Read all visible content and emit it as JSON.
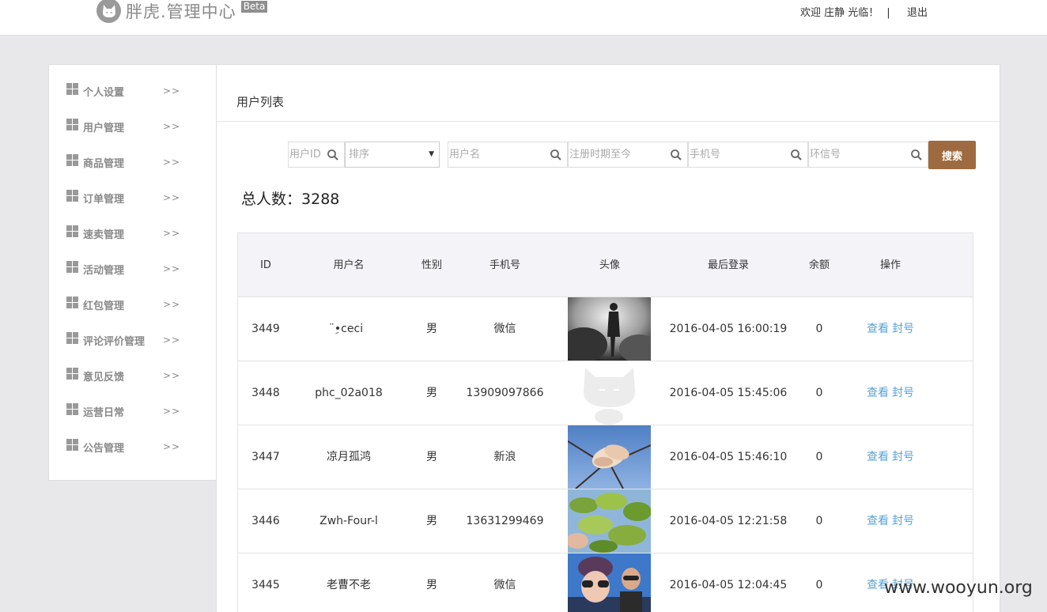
{
  "header": {
    "logo_text": "胖虎.管理中心",
    "beta": "Beta",
    "welcome": "欢迎 庄静 光临！",
    "separator": "|",
    "logout": "退出"
  },
  "sidebar": {
    "items": [
      {
        "label": "个人设置",
        "arrow": ">>"
      },
      {
        "label": "用户管理",
        "arrow": ">>"
      },
      {
        "label": "商品管理",
        "arrow": ">>"
      },
      {
        "label": "订单管理",
        "arrow": ">>"
      },
      {
        "label": "速卖管理",
        "arrow": ">>"
      },
      {
        "label": "活动管理",
        "arrow": ">>"
      },
      {
        "label": "红包管理",
        "arrow": ">>"
      },
      {
        "label": "评论评价管理",
        "arrow": ">>"
      },
      {
        "label": "意见反馈",
        "arrow": ">>"
      },
      {
        "label": "运营日常",
        "arrow": ">>"
      },
      {
        "label": "公告管理",
        "arrow": ">>"
      }
    ]
  },
  "main": {
    "title": "用户列表",
    "search": {
      "user_id_placeholder": "用户ID",
      "sort_label": "排序",
      "username_placeholder": "用户名",
      "regdate_placeholder": "注册时期至今",
      "phone_placeholder": "手机号",
      "huanxin_placeholder": "环信号",
      "button": "搜索"
    },
    "total_label": "总人数：",
    "total_value": "3288",
    "table": {
      "headers": [
        "ID",
        "用户名",
        "性别",
        "手机号",
        "头像",
        "最后登录",
        "余额",
        "操作"
      ],
      "rows": [
        {
          "id": "3449",
          "name": "ِ̈•ceci",
          "sex": "男",
          "phone": "微信",
          "avatar": "photo-silhouette",
          "last": "2016-04-05 16:00:19",
          "balance": "0",
          "view": "查看",
          "ban": "封号"
        },
        {
          "id": "3448",
          "name": "phc_02a018",
          "sex": "男",
          "phone": "13909097866",
          "avatar": "default-cat",
          "last": "2016-04-05 15:45:06",
          "balance": "0",
          "view": "查看",
          "ban": "封号"
        },
        {
          "id": "3447",
          "name": "凉月孤鸿",
          "sex": "男",
          "phone": "新浪",
          "avatar": "photo-magnolia",
          "last": "2016-04-05 15:46:10",
          "balance": "0",
          "view": "查看",
          "ban": "封号"
        },
        {
          "id": "3446",
          "name": "Zwh-Four-l",
          "sex": "男",
          "phone": "13631299469",
          "avatar": "photo-leaves",
          "last": "2016-04-05 12:21:58",
          "balance": "0",
          "view": "查看",
          "ban": "封号"
        },
        {
          "id": "3445",
          "name": "老曹不老",
          "sex": "男",
          "phone": "微信",
          "avatar": "photo-selfie",
          "last": "2016-04-05 12:04:45",
          "balance": "0",
          "view": "查看",
          "ban": "封号"
        }
      ]
    }
  },
  "watermark": "www.wooyun.org",
  "colors": {
    "accent_button": "#9e6a3f",
    "link": "#5aa3d6",
    "page_bg": "#e8e8ea"
  }
}
